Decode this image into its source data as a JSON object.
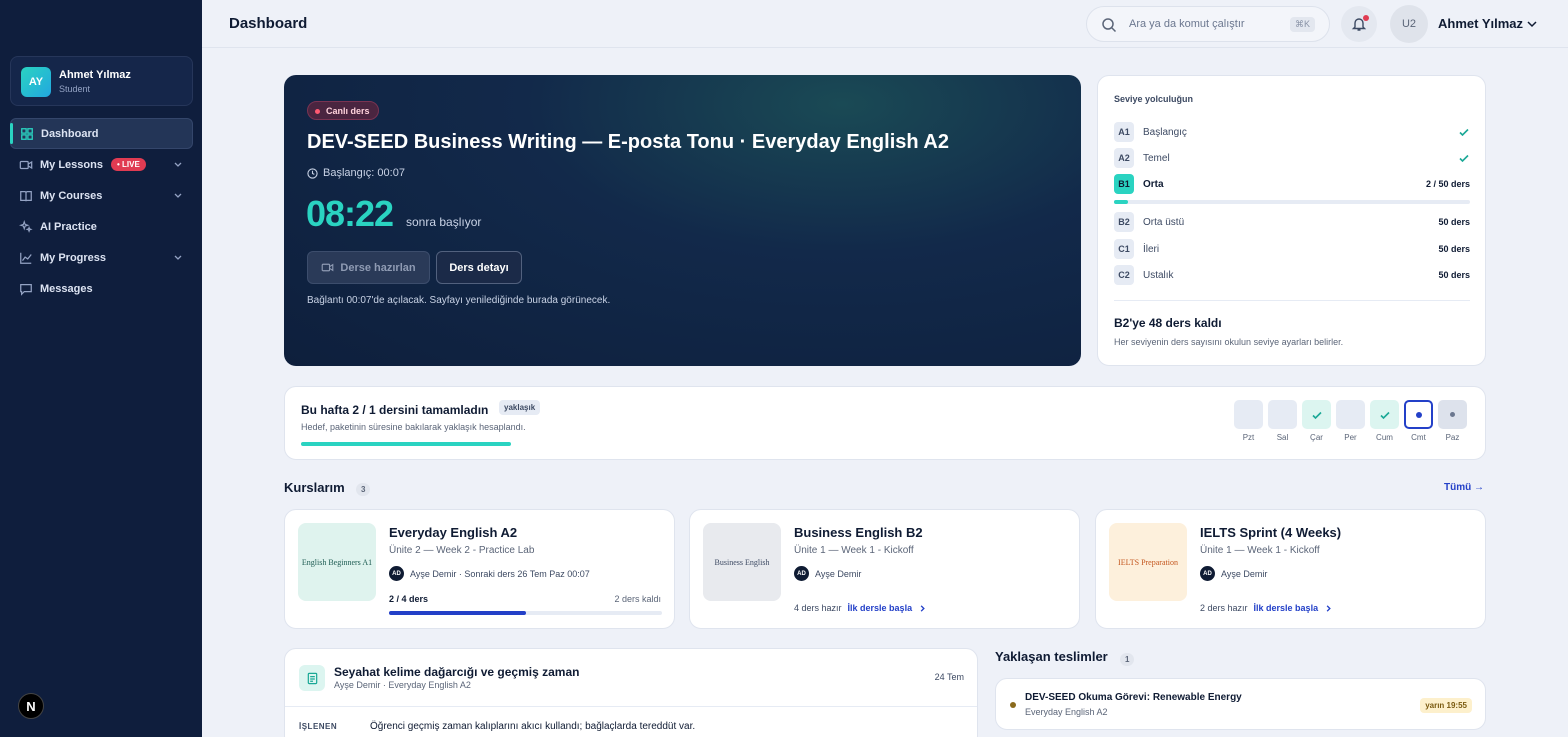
{
  "sidebar": {
    "user": {
      "initials": "AY",
      "name": "Ahmet Yılmaz",
      "role": "Student"
    },
    "items": [
      {
        "label": "Dashboard",
        "icon": "grid-icon",
        "active": true
      },
      {
        "label": "My Lessons",
        "icon": "video-icon",
        "badge": "• LIVE",
        "expandable": true
      },
      {
        "label": "My Courses",
        "icon": "book-icon",
        "expandable": true
      },
      {
        "label": "AI Practice",
        "icon": "sparkles-icon"
      },
      {
        "label": "My Progress",
        "icon": "chart-icon",
        "expandable": true
      },
      {
        "label": "Messages",
        "icon": "message-icon"
      }
    ],
    "logo_letter": "N"
  },
  "header": {
    "title": "Dashboard",
    "search_placeholder": "Ara ya da komut çalıştır",
    "search_shortcut": "⌘K",
    "avatar_initials": "U2",
    "user_name": "Ahmet Yılmaz"
  },
  "hero": {
    "live_label": "Canlı ders",
    "title": "DEV-SEED Business Writing — E-posta Tonu · Everyday English A2",
    "start_label": "Başlangıç: 00:07",
    "countdown": "08:22",
    "countdown_suffix": "sonra başlıyor",
    "prepare_button": "Derse hazırlan",
    "detail_button": "Ders detayı",
    "note": "Bağlantı 00:07'de açılacak. Sayfayı yenilediğinde burada görünecek."
  },
  "level": {
    "heading": "Seviye yolculuğun",
    "levels": [
      {
        "code": "A1",
        "name": "Başlangıç",
        "status": "done"
      },
      {
        "code": "A2",
        "name": "Temel",
        "status": "done"
      },
      {
        "code": "B1",
        "name": "Orta",
        "status": "current",
        "right": "2 / 50 ders"
      },
      {
        "code": "B2",
        "name": "Orta üstü",
        "right": "50 ders"
      },
      {
        "code": "C1",
        "name": "İleri",
        "right": "50 ders"
      },
      {
        "code": "C2",
        "name": "Ustalık",
        "right": "50 ders"
      }
    ],
    "current_progress": 0.04,
    "remaining_title": "B2'ye 48 ders kaldı",
    "remaining_sub": "Her seviyenin ders sayısını okulun seviye ayarları belirler."
  },
  "week": {
    "title": "Bu hafta 2 / 1 dersini tamamladın",
    "badge": "yaklaşık",
    "subtitle": "Hedef, paketinin süresine bakılarak yaklaşık hesaplandı.",
    "progress": 1.0,
    "days": [
      {
        "label": "Pzt",
        "state": "empty"
      },
      {
        "label": "Sal",
        "state": "empty"
      },
      {
        "label": "Çar",
        "state": "done"
      },
      {
        "label": "Per",
        "state": "empty"
      },
      {
        "label": "Cum",
        "state": "done"
      },
      {
        "label": "Cmt",
        "state": "today"
      },
      {
        "label": "Paz",
        "state": "future"
      }
    ]
  },
  "courses": {
    "title": "Kurslarım",
    "count": "3",
    "see_all": "Tümü →",
    "items": [
      {
        "thumb_text": "English Beginners A1",
        "thumb_bg": "#dff3ee",
        "thumb_color": "#1d5b52",
        "name": "Everyday English A2",
        "unit": "Ünite 2 — Week 2 - Practice Lab",
        "teacher_initials": "AD",
        "teacher": "Ayşe Demir · Sonraki ders 26 Tem Paz 00:07",
        "progress_label": "2 / 4 ders",
        "remaining": "2 ders kaldı",
        "progress": 0.5
      },
      {
        "thumb_text": "Business English",
        "thumb_bg": "#e8eaee",
        "thumb_color": "#3d4a63",
        "name": "Business English B2",
        "unit": "Ünite 1 — Week 1 - Kickoff",
        "teacher_initials": "AD",
        "teacher": "Ayşe Demir",
        "ready": "4 ders hazır",
        "start_link": "İlk dersle başla"
      },
      {
        "thumb_text": "IELTS Preparation",
        "thumb_bg": "#fdf0dc",
        "thumb_color": "#c4571f",
        "name": "IELTS Sprint (4 Weeks)",
        "unit": "Ünite 1 — Week 1 - Kickoff",
        "teacher_initials": "AD",
        "teacher": "Ayşe Demir",
        "ready": "2 ders hazır",
        "start_link": "İlk dersle başla"
      }
    ]
  },
  "lesson_note": {
    "title": "Seyahat kelime dağarcığı ve geçmiş zaman",
    "subtitle": "Ayşe Demir · Everyday English A2",
    "date": "24 Tem",
    "label": "İŞLENEN",
    "text": "Öğrenci geçmiş zaman kalıplarını akıcı kullandı; bağlaçlarda tereddüt var."
  },
  "upcoming": {
    "title": "Yaklaşan teslimler",
    "count": "1",
    "item_title": "DEV-SEED Okuma Görevi: Renewable Energy",
    "item_sub": "Everyday English A2",
    "due": "yarın 19:55"
  }
}
